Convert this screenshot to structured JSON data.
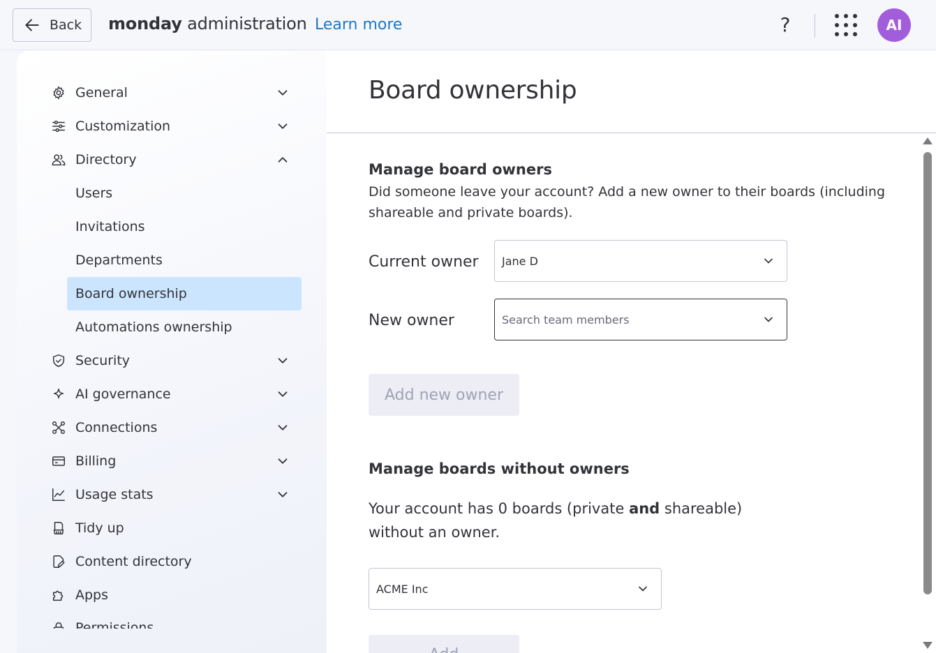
{
  "topbar": {
    "back_label": "Back",
    "brand": "monday",
    "title": "administration",
    "learn_more": "Learn more",
    "help": "?",
    "avatar_initials": "AI",
    "avatar_color": "#a25ddc"
  },
  "sidebar": {
    "items": [
      {
        "label": "General",
        "icon": "gear-icon",
        "expanded": false
      },
      {
        "label": "Customization",
        "icon": "sliders-icon",
        "expanded": false
      },
      {
        "label": "Directory",
        "icon": "people-icon",
        "expanded": true
      },
      {
        "label": "Security",
        "icon": "shield-icon",
        "expanded": false
      },
      {
        "label": "AI governance",
        "icon": "sparkle-icon",
        "expanded": false
      },
      {
        "label": "Connections",
        "icon": "connections-icon",
        "expanded": false
      },
      {
        "label": "Billing",
        "icon": "credit-card-icon",
        "expanded": false
      },
      {
        "label": "Usage stats",
        "icon": "chart-line-icon",
        "expanded": false
      },
      {
        "label": "Tidy up",
        "icon": "broom-icon"
      },
      {
        "label": "Content directory",
        "icon": "document-edit-icon"
      },
      {
        "label": "Apps",
        "icon": "puzzle-icon"
      },
      {
        "label": "Permissions",
        "icon": "lock-icon"
      }
    ],
    "directory_children": [
      {
        "label": "Users"
      },
      {
        "label": "Invitations"
      },
      {
        "label": "Departments"
      },
      {
        "label": "Board ownership",
        "active": true
      },
      {
        "label": "Automations ownership"
      }
    ],
    "active_color": "#cce5ff"
  },
  "main": {
    "title": "Board ownership",
    "manage_owners": {
      "title": "Manage board owners",
      "description": "Did someone leave your account? Add a new owner to their boards (including shareable and private boards).",
      "current_owner_label": "Current owner",
      "current_owner_value": "Jane D",
      "new_owner_label": "New owner",
      "new_owner_placeholder": "Search team members",
      "add_button": "Add new owner"
    },
    "without_owners": {
      "title": "Manage boards without owners",
      "text_before": "Your account has 0 boards (private ",
      "text_bold": "and",
      "text_after": " shareable) without an owner.",
      "workspace_value": "ACME Inc",
      "add_button": "Add"
    }
  }
}
